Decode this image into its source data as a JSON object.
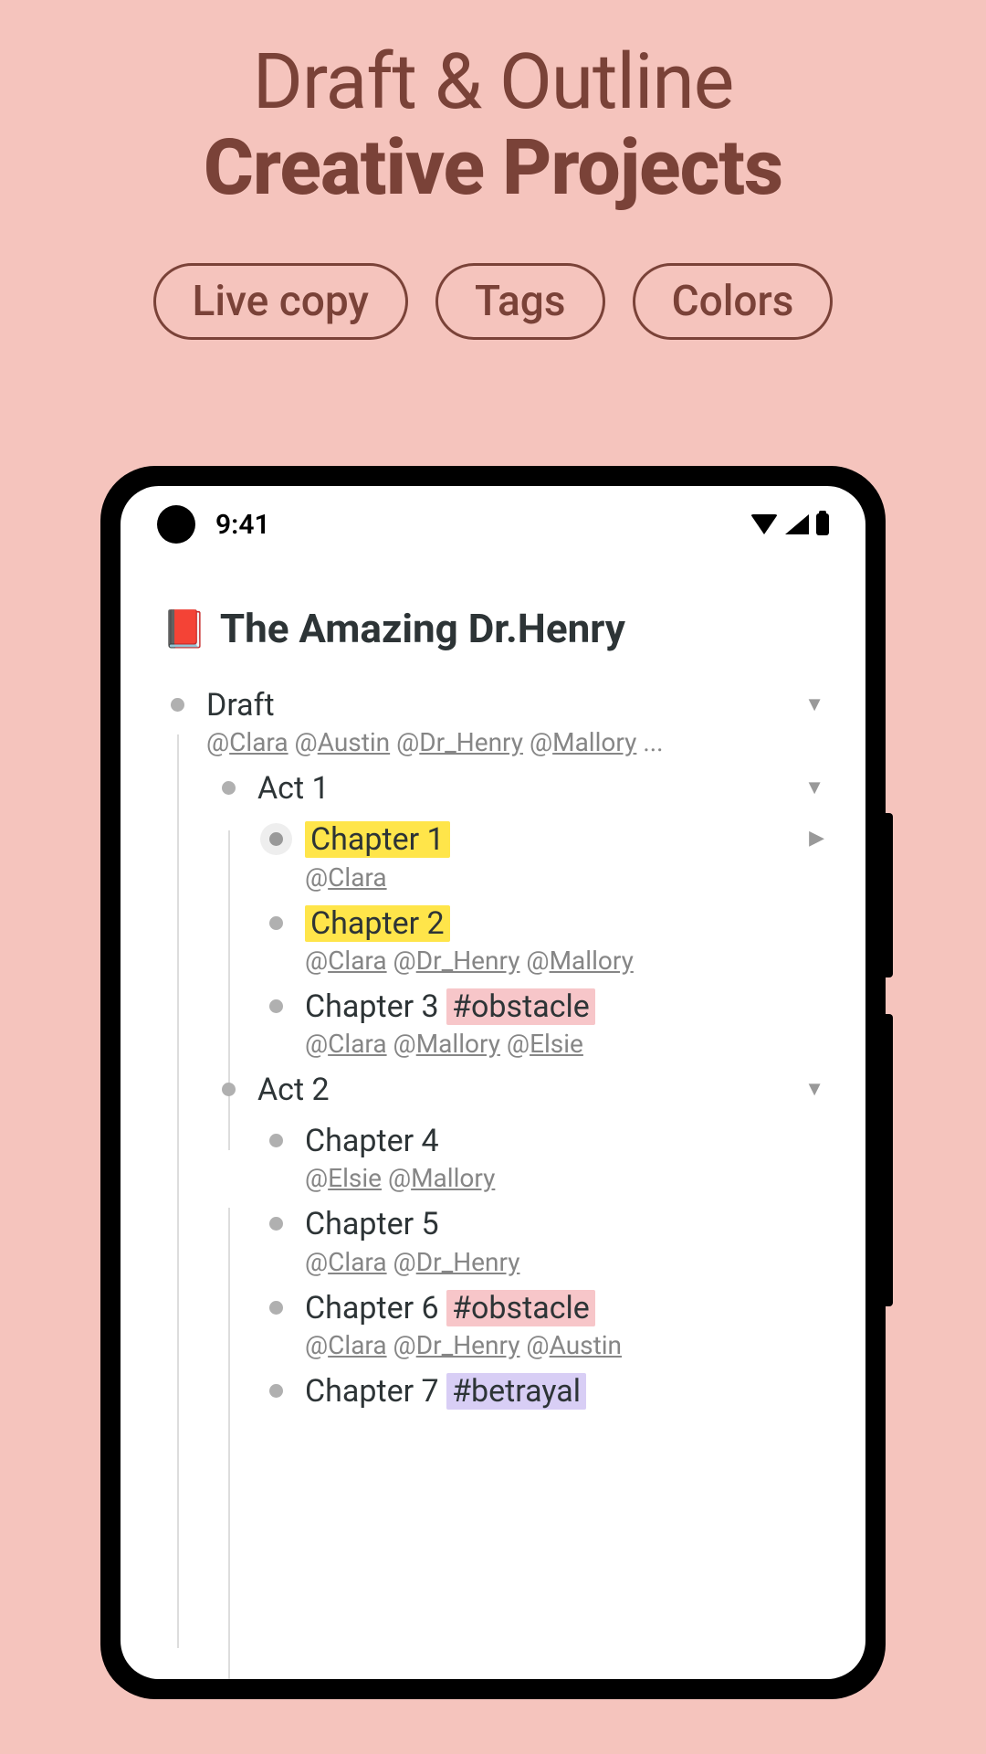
{
  "hero": {
    "line1": "Draft & Outline",
    "line2": "Creative Projects"
  },
  "pills": [
    "Live copy",
    "Tags",
    "Colors"
  ],
  "statusbar": {
    "time": "9:41"
  },
  "doc": {
    "emoji": "📕",
    "title": "The Amazing Dr.Henry"
  },
  "outline": [
    {
      "level": 1,
      "title": "Draft",
      "chevron": "▼",
      "mentions": [
        "Clara",
        "Austin",
        "Dr_Henry",
        "Mallory"
      ],
      "mentions_suffix": " ..."
    },
    {
      "level": 2,
      "title": "Act 1",
      "chevron": "▼"
    },
    {
      "level": 3,
      "title": "Chapter 1",
      "highlight": "yellow",
      "selected": true,
      "chevron": "▶",
      "mentions": [
        "Clara"
      ]
    },
    {
      "level": 3,
      "title": "Chapter 2",
      "highlight": "yellow",
      "mentions": [
        "Clara",
        "Dr_Henry",
        "Mallory"
      ]
    },
    {
      "level": 3,
      "title": "Chapter 3",
      "tag": "#obstacle",
      "tag_color": "pink",
      "mentions": [
        "Clara",
        "Mallory",
        "Elsie"
      ]
    },
    {
      "level": 2,
      "title": "Act 2",
      "chevron": "▼"
    },
    {
      "level": 3,
      "title": "Chapter 4",
      "mentions": [
        "Elsie",
        "Mallory"
      ]
    },
    {
      "level": 3,
      "title": "Chapter 5",
      "mentions": [
        "Clara",
        "Dr_Henry"
      ]
    },
    {
      "level": 3,
      "title": "Chapter 6",
      "tag": "#obstacle",
      "tag_color": "pink",
      "mentions": [
        "Clara",
        "Dr_Henry",
        "Austin"
      ]
    },
    {
      "level": 3,
      "title": "Chapter 7",
      "tag": "#betrayal",
      "tag_color": "purple"
    }
  ]
}
